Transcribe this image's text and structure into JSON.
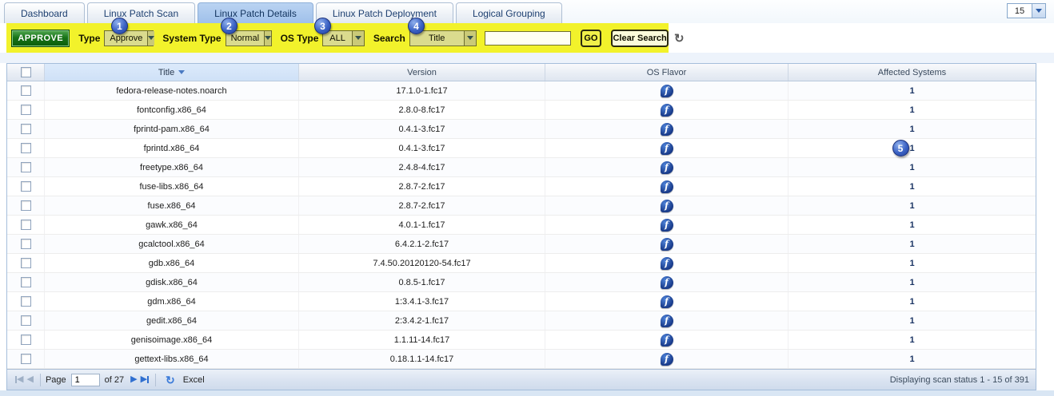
{
  "tabs": {
    "items": [
      {
        "label": "Dashboard",
        "active": false
      },
      {
        "label": "Linux Patch Scan",
        "active": false
      },
      {
        "label": "Linux Patch Details",
        "active": true
      },
      {
        "label": "Linux Patch Deployment",
        "active": false
      },
      {
        "label": "Logical Grouping",
        "active": false
      }
    ],
    "page_size_value": "15"
  },
  "toolbar": {
    "approve_label": "APPROVE",
    "type": {
      "label": "Type",
      "value": "Approve"
    },
    "system_type": {
      "label": "System Type",
      "value": "Normal"
    },
    "os_type": {
      "label": "OS Type",
      "value": "ALL"
    },
    "search": {
      "label": "Search",
      "value": "Title"
    },
    "search_input": {
      "value": "",
      "placeholder": ""
    },
    "go_label": "GO",
    "clear_label": "Clear Search"
  },
  "annotations": {
    "labels": [
      "1",
      "2",
      "3",
      "4",
      "5"
    ]
  },
  "table": {
    "columns": {
      "title": "Title",
      "version": "Version",
      "os_flavor": "OS Flavor",
      "affected": "Affected Systems"
    },
    "sort": {
      "column": "Title",
      "direction": "down"
    },
    "rows": [
      {
        "title": "fedora-release-notes.noarch",
        "version": "17.1.0-1.fc17",
        "os_flavor": "fedora",
        "affected": "1"
      },
      {
        "title": "fontconfig.x86_64",
        "version": "2.8.0-8.fc17",
        "os_flavor": "fedora",
        "affected": "1"
      },
      {
        "title": "fprintd-pam.x86_64",
        "version": "0.4.1-3.fc17",
        "os_flavor": "fedora",
        "affected": "1"
      },
      {
        "title": "fprintd.x86_64",
        "version": "0.4.1-3.fc17",
        "os_flavor": "fedora",
        "affected": "1",
        "annotated": true
      },
      {
        "title": "freetype.x86_64",
        "version": "2.4.8-4.fc17",
        "os_flavor": "fedora",
        "affected": "1"
      },
      {
        "title": "fuse-libs.x86_64",
        "version": "2.8.7-2.fc17",
        "os_flavor": "fedora",
        "affected": "1"
      },
      {
        "title": "fuse.x86_64",
        "version": "2.8.7-2.fc17",
        "os_flavor": "fedora",
        "affected": "1"
      },
      {
        "title": "gawk.x86_64",
        "version": "4.0.1-1.fc17",
        "os_flavor": "fedora",
        "affected": "1"
      },
      {
        "title": "gcalctool.x86_64",
        "version": "6.4.2.1-2.fc17",
        "os_flavor": "fedora",
        "affected": "1"
      },
      {
        "title": "gdb.x86_64",
        "version": "7.4.50.20120120-54.fc17",
        "os_flavor": "fedora",
        "affected": "1"
      },
      {
        "title": "gdisk.x86_64",
        "version": "0.8.5-1.fc17",
        "os_flavor": "fedora",
        "affected": "1"
      },
      {
        "title": "gdm.x86_64",
        "version": "1:3.4.1-3.fc17",
        "os_flavor": "fedora",
        "affected": "1"
      },
      {
        "title": "gedit.x86_64",
        "version": "2:3.4.2-1.fc17",
        "os_flavor": "fedora",
        "affected": "1"
      },
      {
        "title": "genisoimage.x86_64",
        "version": "1.1.11-14.fc17",
        "os_flavor": "fedora",
        "affected": "1"
      },
      {
        "title": "gettext-libs.x86_64",
        "version": "0.18.1.1-14.fc17",
        "os_flavor": "fedora",
        "affected": "1"
      }
    ]
  },
  "pagination": {
    "page_label": "Page",
    "page_value": "1",
    "of_label": "of 27",
    "excel_label": "Excel",
    "status": "Displaying scan status 1 - 15 of 391"
  },
  "colors": {
    "highlight_yellow": "#f2f22b",
    "approve_green": "#187418",
    "active_tab_blue": "#a9c8ee",
    "annotation_blue": "#3b62c4",
    "fedora_blue": "#1b3e8e",
    "affected_navy": "#1a3464"
  }
}
